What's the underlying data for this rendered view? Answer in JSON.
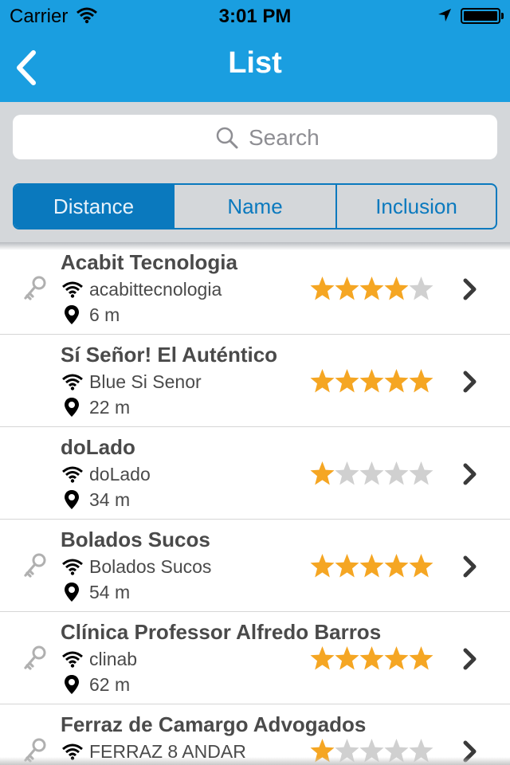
{
  "status_bar": {
    "carrier": "Carrier",
    "time": "3:01 PM",
    "battery_level": 1.0
  },
  "nav": {
    "title": "List",
    "back_icon": "chevron-left-icon"
  },
  "search": {
    "placeholder": "Search"
  },
  "sort_segments": [
    {
      "label": "Distance",
      "selected": true
    },
    {
      "label": "Name",
      "selected": false
    },
    {
      "label": "Inclusion",
      "selected": false
    }
  ],
  "colors": {
    "nav_bar": "#1a9ee0",
    "segment_accent": "#0a79be",
    "star_filled": "#f5a623",
    "star_empty": "#d0d0d0"
  },
  "places": [
    {
      "name": "Acabit Tecnologia",
      "ssid": "acabittecnologia",
      "distance": "6 m",
      "rating": 4,
      "has_key": true
    },
    {
      "name": "Sí Señor! El Auténtico",
      "ssid": "Blue Si Senor",
      "distance": "22 m",
      "rating": 5,
      "has_key": false
    },
    {
      "name": "doLado",
      "ssid": "doLado",
      "distance": "34 m",
      "rating": 1,
      "has_key": false
    },
    {
      "name": "Bolados Sucos",
      "ssid": "Bolados Sucos",
      "distance": "54 m",
      "rating": 5,
      "has_key": true
    },
    {
      "name": "Clínica Professor Alfredo Barros",
      "ssid": "clinab",
      "distance": "62 m",
      "rating": 5,
      "has_key": true
    },
    {
      "name": "Ferraz de Camargo Advogados",
      "ssid": "FERRAZ 8 ANDAR",
      "distance": "",
      "rating": 1,
      "has_key": true
    }
  ]
}
